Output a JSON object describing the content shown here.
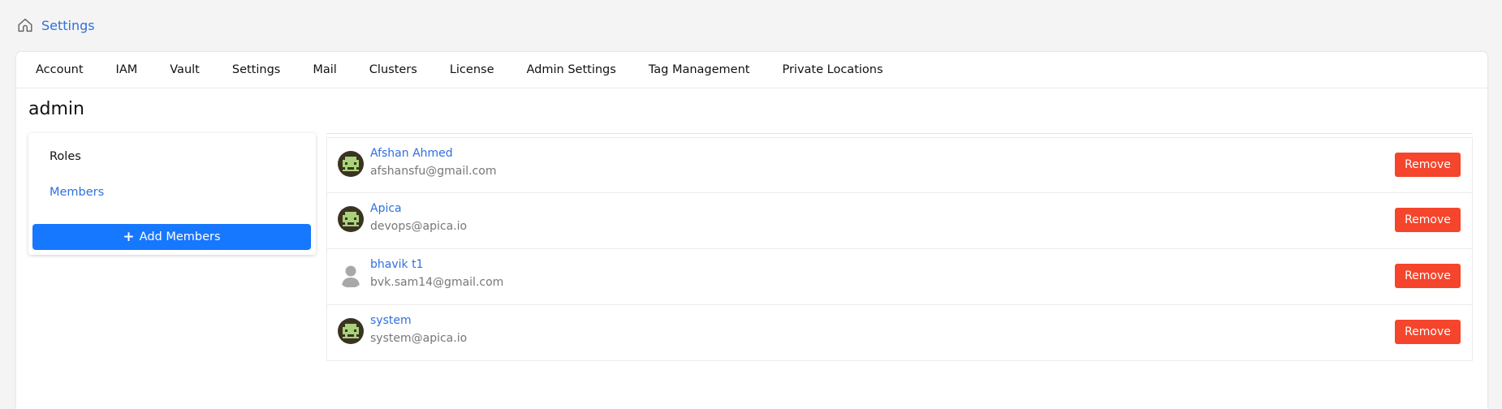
{
  "breadcrumb": {
    "icon": "home-icon",
    "label": "Settings"
  },
  "tabs": [
    "Account",
    "IAM",
    "Vault",
    "Settings",
    "Mail",
    "Clusters",
    "License",
    "Admin Settings",
    "Tag Management",
    "Private Locations"
  ],
  "page_title": "admin",
  "side_menu": {
    "roles_label": "Roles",
    "members_label": "Members",
    "add_button_label": "Add Members",
    "add_button_icon": "plus-icon"
  },
  "members": [
    {
      "name": "Afshan Ahmed",
      "email": "afshansfu@gmail.com",
      "avatar": "pixel-avatar-icon",
      "remove_label": "Remove"
    },
    {
      "name": "Apica",
      "email": "devops@apica.io",
      "avatar": "pixel-avatar-icon",
      "remove_label": "Remove"
    },
    {
      "name": "bhavik t1",
      "email": "bvk.sam14@gmail.com",
      "avatar": "default-user-icon",
      "remove_label": "Remove"
    },
    {
      "name": "system",
      "email": "system@apica.io",
      "avatar": "pixel-avatar-icon",
      "remove_label": "Remove"
    }
  ],
  "colors": {
    "link": "#2f6fe0",
    "primary": "#1677ff",
    "danger": "#f5452c",
    "avatar_bg": "#3b3322",
    "avatar_fg": "#a9d27a"
  }
}
